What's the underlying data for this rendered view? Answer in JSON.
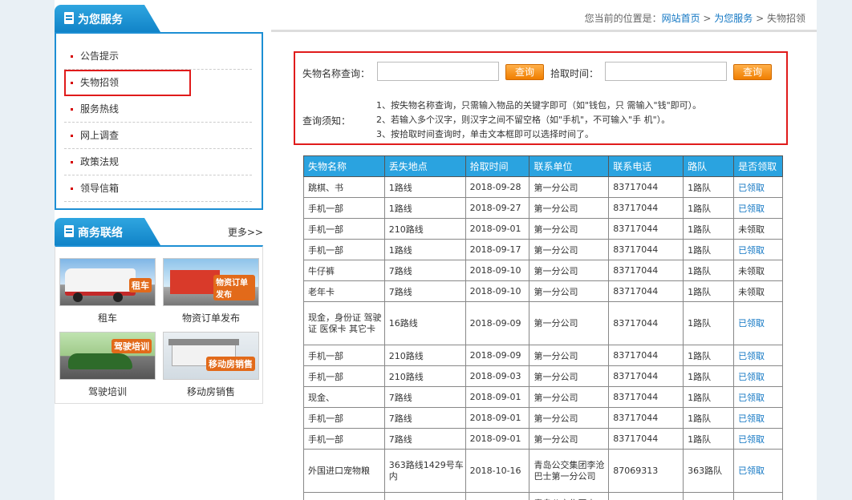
{
  "services": {
    "title": "为您服务",
    "items": [
      "公告提示",
      "失物招领",
      "服务热线",
      "网上调查",
      "政策法规",
      "领导信箱"
    ],
    "selected_index": 1
  },
  "business": {
    "title": "商务联络",
    "more": "更多>>",
    "cards": [
      {
        "label": "租车",
        "tag": "租车"
      },
      {
        "label": "物资订单发布",
        "tag": "物资订单发布"
      },
      {
        "label": "驾驶培训",
        "tag": "驾驶培训"
      },
      {
        "label": "移动房销售",
        "tag": "移动房销售"
      }
    ]
  },
  "breadcrumb": {
    "prefix": "您当前的位置是：",
    "home": "网站首页",
    "sep": " > ",
    "section": "为您服务",
    "current": "失物招领"
  },
  "search": {
    "name_label": "失物名称查询：",
    "time_label": "拾取时间：",
    "button": "查询",
    "notice_label": "查询须知：",
    "notes": [
      "1、按失物名称查询，只需输入物品的关键字即可（如\"钱包，只 需输入\"钱\"即可）。",
      "2、若输入多个汉字，则汉字之间不留空格（如\"手机\"，不可输入\"手 机\"）。",
      "3、按拾取时间查询时，单击文本框即可以选择时间了。"
    ]
  },
  "table": {
    "headers": [
      "失物名称",
      "丢失地点",
      "拾取时间",
      "联系单位",
      "联系电话",
      "路队",
      "是否领取"
    ],
    "rows": [
      [
        "跳棋、书",
        "1路线",
        "2018-09-28",
        "第一分公司",
        "83717044",
        "1路队",
        "已领取"
      ],
      [
        "手机一部",
        "1路线",
        "2018-09-27",
        "第一分公司",
        "83717044",
        "1路队",
        "已领取"
      ],
      [
        "手机一部",
        "210路线",
        "2018-09-01",
        "第一分公司",
        "83717044",
        "1路队",
        "未领取"
      ],
      [
        "手机一部",
        "1路线",
        "2018-09-17",
        "第一分公司",
        "83717044",
        "1路队",
        "已领取"
      ],
      [
        "牛仔裤",
        "7路线",
        "2018-09-10",
        "第一分公司",
        "83717044",
        "1路队",
        "未领取"
      ],
      [
        "老年卡",
        "7路线",
        "2018-09-10",
        "第一分公司",
        "83717044",
        "1路队",
        "未领取"
      ],
      [
        "现金，身份证 驾驶证 医保卡 其它卡",
        "16路线",
        "2018-09-09",
        "第一分公司",
        "83717044",
        "1路队",
        "已领取"
      ],
      [
        "手机一部",
        "210路线",
        "2018-09-09",
        "第一分公司",
        "83717044",
        "1路队",
        "已领取"
      ],
      [
        "手机一部",
        "210路线",
        "2018-09-03",
        "第一分公司",
        "83717044",
        "1路队",
        "已领取"
      ],
      [
        "现金、",
        "7路线",
        "2018-09-01",
        "第一分公司",
        "83717044",
        "1路队",
        "已领取"
      ],
      [
        "手机一部",
        "7路线",
        "2018-09-01",
        "第一分公司",
        "83717044",
        "1路队",
        "已领取"
      ],
      [
        "手机一部",
        "7路线",
        "2018-09-01",
        "第一分公司",
        "83717044",
        "1路队",
        "已领取"
      ],
      [
        "外国进口宠物粮",
        "363路线1429号车内",
        "2018-10-16",
        "青岛公交集团李沧巴士第一分公司",
        "87069313",
        "363路队",
        "已领取"
      ],
      [
        "",
        "",
        "",
        "青岛公交集团李",
        "",
        "",
        ""
      ]
    ]
  }
}
